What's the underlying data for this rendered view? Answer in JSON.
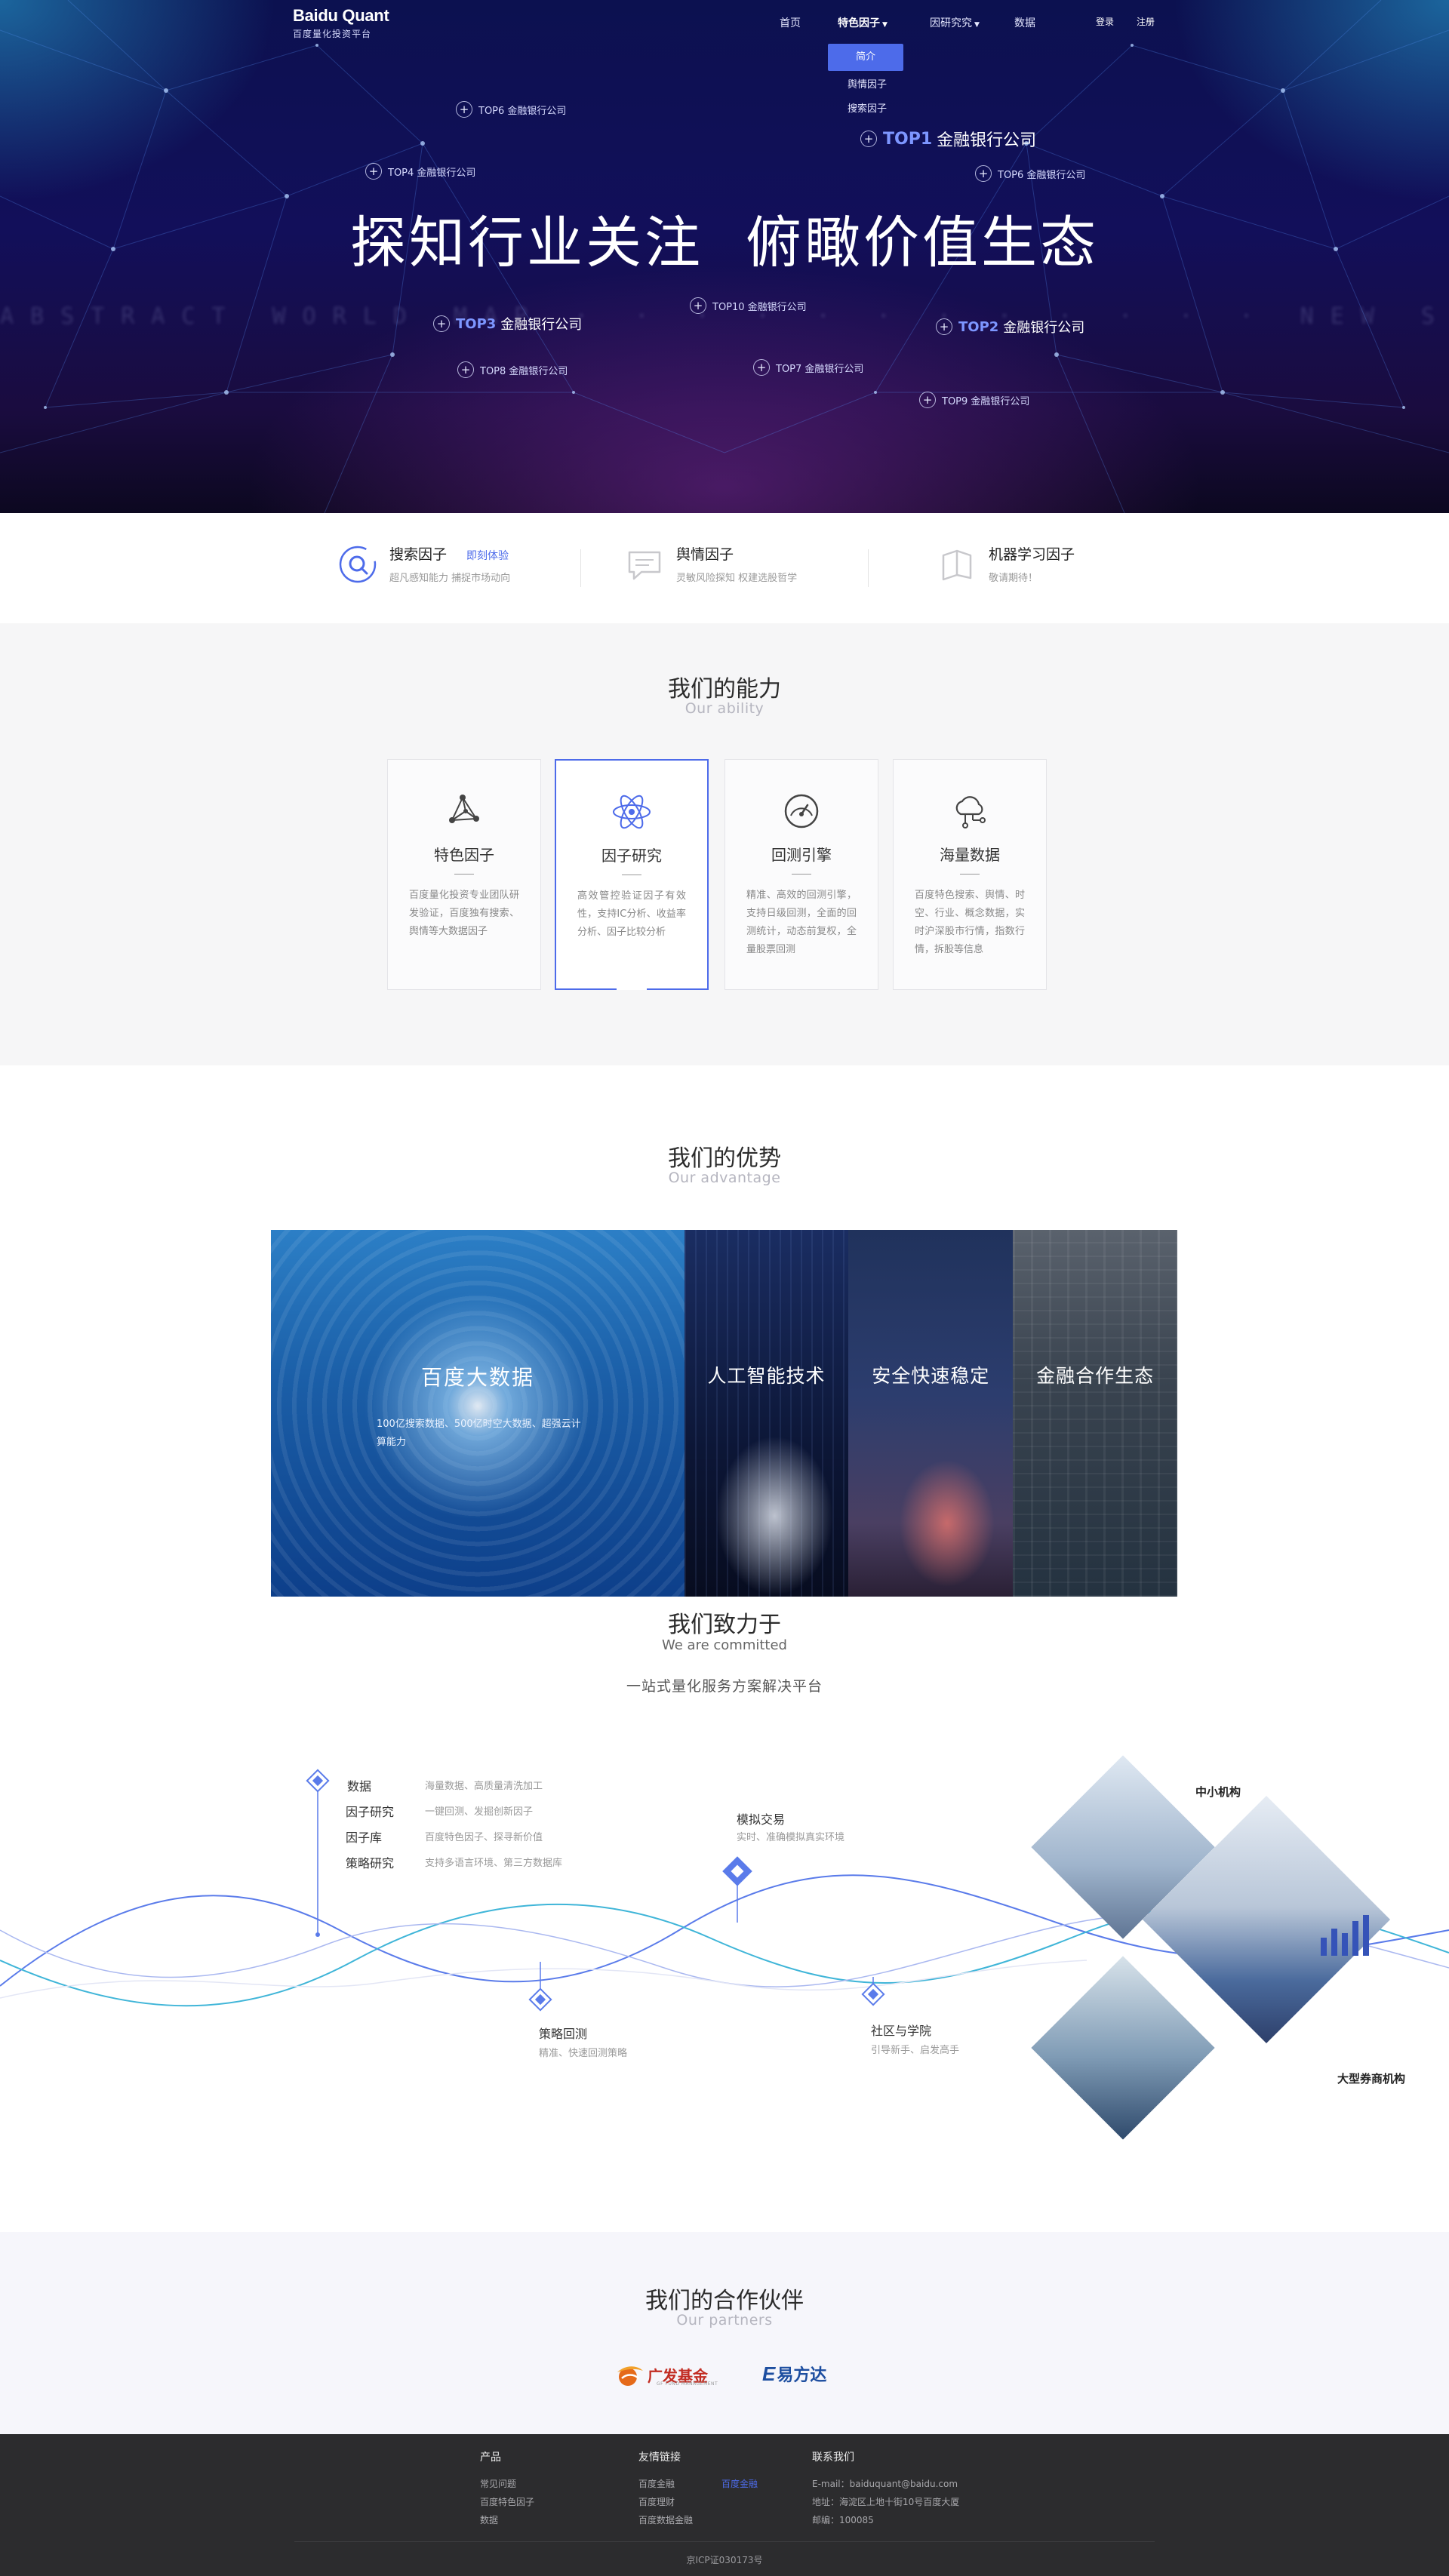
{
  "nav": {
    "logo_title": "Baidu Quant",
    "logo_subtitle": "百度量化投资平台",
    "items": [
      "首页",
      "特色因子",
      "因研究究",
      "数据"
    ],
    "login": "登录",
    "register": "注册",
    "dropdown": [
      "简介",
      "舆情因子",
      "搜索因子"
    ]
  },
  "hero": {
    "title_left": "探知行业关注",
    "title_right": "俯瞰价值生态",
    "tags": {
      "top1": {
        "rank": "TOP1",
        "name": "金融银行公司"
      },
      "top2": {
        "rank": "TOP2",
        "name": "金融银行公司"
      },
      "top3": {
        "rank": "TOP3",
        "name": "金融银行公司"
      },
      "top4": "TOP4 金融银行公司",
      "top5": "TOP6 金融银行公司",
      "top6": "TOP6 金融银行公司",
      "top7": "TOP7 金融银行公司",
      "top8": "TOP8 金融银行公司",
      "top9": "TOP9 金融银行公司",
      "top10": "TOP10 金融银行公司"
    }
  },
  "features": [
    {
      "title": "搜索因子",
      "link": "即刻体验",
      "desc": "超凡感知能力  捕捉市场动向"
    },
    {
      "title": "舆情因子",
      "desc": "灵敏风险探知  权建选股哲学"
    },
    {
      "title": "机器学习因子",
      "desc": "敬请期待！"
    }
  ],
  "ability": {
    "title": "我们的能力",
    "subtitle": "Our ability",
    "cards": [
      {
        "title": "特色因子",
        "desc": "百度量化投资专业团队研发验证，百度独有搜索、舆情等大数据因子",
        "icon": "network-graph-icon"
      },
      {
        "title": "因子研究",
        "desc": "高效管控验证因子有效性，支持IC分析、收益率分析、因子比较分析",
        "icon": "atom-icon"
      },
      {
        "title": "回测引擎",
        "desc": "精准、高效的回测引擎，支持日级回测，全面的回测统计，动态前复权，全量股票回测",
        "icon": "gauge-icon"
      },
      {
        "title": "海量数据",
        "desc": "百度特色搜索、舆情、时空、行业、概念数据，实时沪深股市行情，指数行情，拆股等信息",
        "icon": "cloud-data-icon"
      }
    ]
  },
  "advantage": {
    "title": "我们的优势",
    "subtitle": "Our advantage",
    "big_title": "百度大数据",
    "big_desc": "100亿搜索数据、500亿时空大数据、超强云计算能力",
    "cols": [
      "人工智能技术",
      "安全快速稳定",
      "金融合作生态"
    ]
  },
  "committed": {
    "title": "我们致力于",
    "subtitle": "We are committed",
    "slogan": "一站式量化服务方案解决平台",
    "list": [
      {
        "name": "数据",
        "desc": "海量数据、高质量清洗加工"
      },
      {
        "name": "因子研究",
        "desc": "一键回测、发掘创新因子"
      },
      {
        "name": "因子库",
        "desc": "百度特色因子、探寻新价值"
      },
      {
        "name": "策略研究",
        "desc": "支持多语言环境、第三方数据库"
      }
    ],
    "sim_title": "模拟交易",
    "sim_desc": "实时、准确模拟真实环境",
    "back_title": "策略回测",
    "back_desc": "精准、快速回测策略",
    "comm_title": "社区与学院",
    "comm_desc": "引导新手、启发高手",
    "label_small": "中小机构",
    "label_large": "大型券商机构"
  },
  "partners": {
    "title": "我们的合作伙伴",
    "subtitle": "Our partners",
    "gf_name": "广发基金",
    "gf_en": "GF FUND MANAGEMENT",
    "efd_mark": "E",
    "efd_name": "易方达"
  },
  "footer": {
    "products_head": "产品",
    "products": [
      "常见问题",
      "百度特色因子",
      "数据"
    ],
    "links_head": "友情链接",
    "links_col1": [
      "百度金融",
      "百度理财",
      "百度数据金融"
    ],
    "links_col2": [
      "百度金融"
    ],
    "contact_head": "联系我们",
    "contact": [
      "E-mail：baiduquant@baidu.com",
      "地址：海淀区上地十街10号百度大厦",
      "邮编：100085"
    ],
    "icp": "京ICP证030173号"
  },
  "colors": {
    "accent": "#4d6bea",
    "hero_bg": "#120f5a",
    "footer_bg": "#2c2c2e"
  }
}
